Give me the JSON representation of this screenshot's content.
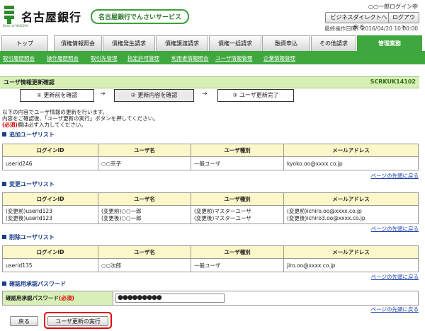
{
  "header": {
    "bank_name": "名古屋銀行",
    "logo_sub": "Bank of NAGOYA",
    "service_name": "名古屋銀行でんさいサービス",
    "user_login": "○○一郎ログイン中",
    "btn_business_direct": "ビジネスダイレクトへ戻る",
    "btn_logout": "ログアウト",
    "last_operation": "最終操作日時：2016/04/20 10:00:00",
    "brand_green": "#3ea83e"
  },
  "tabs": [
    "トップ",
    "債権情報照会",
    "債権発生請求",
    "債権譲渡請求",
    "債権一括請求",
    "融資申込",
    "その他請求",
    "管理業務"
  ],
  "subnav": [
    "取引履歴照会",
    "操作履歴照会",
    "取引先管理",
    "指定許可管理",
    "利用者情報照会",
    "ユーザ情報管理",
    "企業情報管理"
  ],
  "page": {
    "title": "ユーザ情報更新確認",
    "code": "SCRKUK14102"
  },
  "steps": [
    "① 更新前を確認",
    "② 更新内容を確認",
    "③ ユーザ更新完了"
  ],
  "arrow": "→",
  "instructions": {
    "line1": "以下の内容でユーザ情報の更新を行います。",
    "line2": "内容をご確認後、「ユーザ更新の実行」ボタンを押してください。",
    "req_mark": "(必須)",
    "line3_rest": "欄は必ず入力してください。"
  },
  "table_headers": [
    "ログインID",
    "ユーザ名",
    "ユーザ種別",
    "メールアドレス"
  ],
  "page_top_link": "ページの先頭に戻る",
  "sections": {
    "add": {
      "title": "追加ユーザリスト",
      "rows": [
        {
          "login": "userid246",
          "name": "○○京子",
          "type": "一般ユーザ",
          "email": "kyoko.oo@xxxx.co.jp"
        }
      ]
    },
    "change": {
      "title": "変更ユーザリスト",
      "before_label": "(変更前)",
      "after_label": "(変更後)",
      "row": {
        "login_before": "userid123",
        "login_after": "userid123",
        "name_before": "○○一郎",
        "name_after": "○○一郎",
        "type_before": "マスターユーザ",
        "type_after": "マスターユーザ",
        "email_before": "ichiro.oo@xxxx.co.jp",
        "email_after": "ichiro3.oo@xxxx.co.jp"
      }
    },
    "delete": {
      "title": "削除ユーザリスト",
      "rows": [
        {
          "login": "userid135",
          "name": "○○次郎",
          "type": "一般ユーザ",
          "email": "jiro.oo@xxxx.co.jp"
        }
      ]
    },
    "password": {
      "title": "確認用承認パスワード",
      "label": "確認用承認パスワード",
      "req": "(必須)",
      "value": "●●●●●●●●●"
    }
  },
  "buttons": {
    "back": "戻る",
    "execute": "ユーザ更新の実行"
  }
}
